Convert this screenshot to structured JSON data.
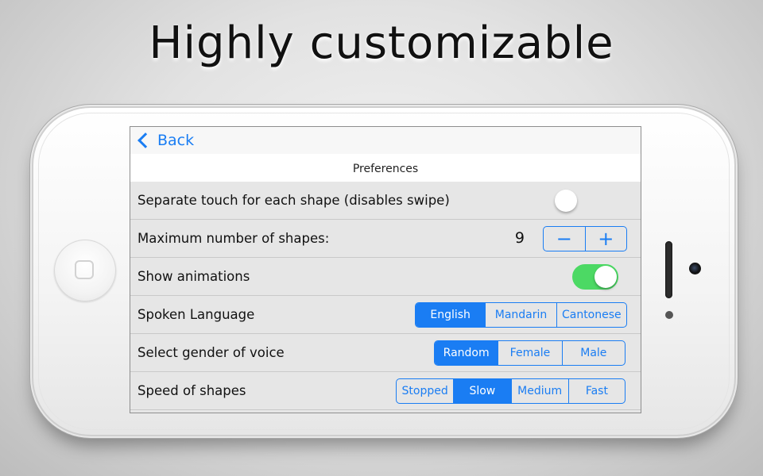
{
  "headline": "Highly customizable",
  "navbar": {
    "back_label": "Back"
  },
  "section_title": "Preferences",
  "rows": {
    "separate_touch": {
      "label": "Separate touch for each shape (disables swipe)",
      "enabled": false
    },
    "max_shapes": {
      "label": "Maximum number of shapes:",
      "value": "9",
      "decrement_symbol": "−",
      "increment_symbol": "+"
    },
    "show_animations": {
      "label": "Show animations",
      "enabled": true
    },
    "spoken_language": {
      "label": "Spoken Language",
      "options": [
        "English",
        "Mandarin",
        "Cantonese"
      ],
      "selected": "English"
    },
    "voice_gender": {
      "label": "Select gender of voice",
      "options": [
        "Random",
        "Female",
        "Male"
      ],
      "selected": "Random"
    },
    "speed": {
      "label": "Speed of shapes",
      "options": [
        "Stopped",
        "Slow",
        "Medium",
        "Fast"
      ],
      "selected": "Slow"
    }
  },
  "colors": {
    "accent": "#1a7df3",
    "toggle_on": "#4cd964",
    "row_background": "#e6e6e6",
    "navbar_background": "#f7f7f7"
  }
}
